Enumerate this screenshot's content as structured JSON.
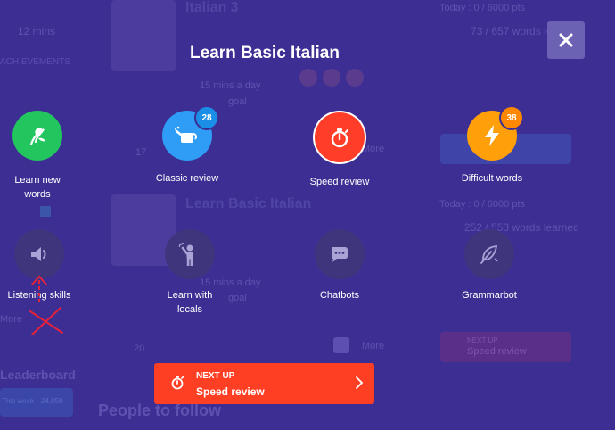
{
  "overlay": {
    "title": "Learn Basic Italian",
    "modes": [
      {
        "id": "learn-new-words",
        "label": "Learn new words",
        "icon": "seedling-icon",
        "color": "#22c55e"
      },
      {
        "id": "classic-review",
        "label": "Classic review",
        "icon": "watering-can-icon",
        "color": "#2f9cf5",
        "badge": "28"
      },
      {
        "id": "speed-review",
        "label": "Speed review",
        "icon": "stopwatch-icon",
        "color": "#ff3d28"
      },
      {
        "id": "difficult-words",
        "label": "Difficult words",
        "icon": "lightning-icon",
        "color": "#ff9f0a",
        "badge": "38"
      },
      {
        "id": "listening-skills",
        "label": "Listening skills",
        "icon": "speaker-icon",
        "color": "#3f357d"
      },
      {
        "id": "learn-with-locals",
        "label": "Learn with locals",
        "icon": "person-waving-icon",
        "color": "#3f357d"
      },
      {
        "id": "chatbots",
        "label": "Chatbots",
        "icon": "chat-bubble-icon",
        "color": "#3f357d"
      },
      {
        "id": "grammarbot",
        "label": "Grammarbot",
        "icon": "feather-icon",
        "color": "#3f357d"
      }
    ],
    "next_up": {
      "kicker": "NEXT UP",
      "label": "Speed review"
    }
  },
  "background": {
    "course1_title": "Italian 3",
    "course1_today": "Today : 0 / 6000 pts",
    "course1_words": "73 / 657 words le",
    "course1_pace": "15 mins a day",
    "course1_goal": "goal",
    "course2_title": "Learn Basic Italian",
    "course2_today": "Today : 0 / 6000 pts",
    "course2_words": "252 / 553 words learned",
    "course2_pace": "15 mins a day",
    "course2_goal": "goal",
    "left_mins": "12 mins",
    "left_link": "ACHIEVEMENTS",
    "more1": "More",
    "more2": "More",
    "count1": "17",
    "count2": "20",
    "next_up_kicker": "NEXT UP",
    "next_up_label": "Speed review",
    "mores": "More",
    "leaderboard": "Leaderboard",
    "people": "People to follow",
    "pts": "24,050",
    "week": "This week"
  },
  "colors": {
    "overlay": "#3d2e93",
    "primary_red": "#ff3f24",
    "close_bg": "#6c62b3"
  }
}
